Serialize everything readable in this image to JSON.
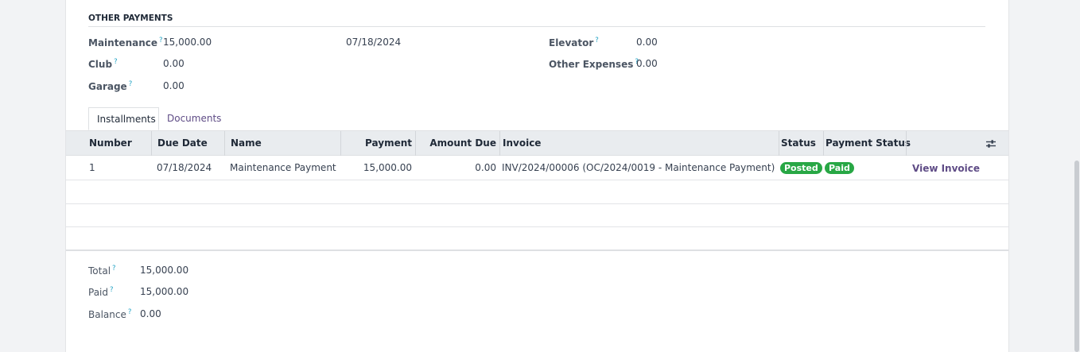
{
  "section": {
    "title": "OTHER PAYMENTS",
    "fields": {
      "maintenance_label": "Maintenance",
      "maintenance_value": "15,000.00",
      "maintenance_date": "07/18/2024",
      "club_label": "Club",
      "club_value": "0.00",
      "garage_label": "Garage",
      "garage_value": "0.00",
      "elevator_label": "Elevator",
      "elevator_value": "0.00",
      "other_expenses_label": "Other Expenses",
      "other_expenses_value": "0.00",
      "help_mark": "?"
    }
  },
  "tabs": [
    {
      "label": "Installments",
      "active": true
    },
    {
      "label": "Documents",
      "active": false
    }
  ],
  "table": {
    "columns": [
      "Number",
      "Due Date",
      "Name",
      "Payment",
      "Amount Due",
      "Invoice",
      "Status",
      "Payment Status"
    ],
    "rows": [
      {
        "number": "1",
        "due_date": "07/18/2024",
        "name": "Maintenance Payment",
        "payment": "15,000.00",
        "amount_due": "0.00",
        "invoice": "INV/2024/00006 (OC/2024/0019 - Maintenance Payment)",
        "status": "Posted",
        "payment_status": "Paid",
        "action": "View Invoice"
      }
    ]
  },
  "totals": {
    "total_label": "Total",
    "total_value": "15,000.00",
    "paid_label": "Paid",
    "paid_value": "15,000.00",
    "balance_label": "Balance",
    "balance_value": "0.00"
  },
  "colors": {
    "accent": "#5f4c86",
    "success": "#28a745",
    "help": "#23a3c5"
  },
  "icons": {
    "column_options": "sliders-icon",
    "help": "question-mark-icon"
  }
}
